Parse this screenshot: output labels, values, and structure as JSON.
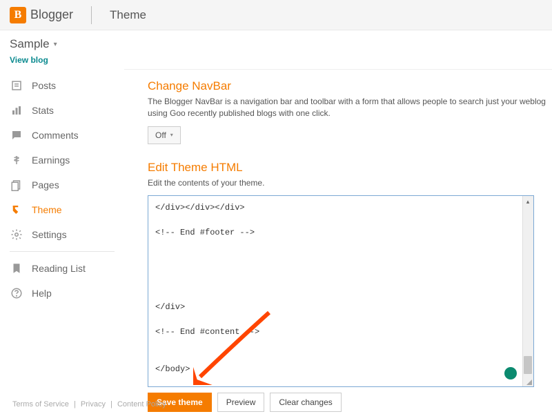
{
  "header": {
    "brand": "Blogger",
    "section": "Theme"
  },
  "blog": {
    "name": "Sample",
    "view_link": "View blog"
  },
  "sidebar": {
    "items": [
      {
        "label": "Posts",
        "icon": "posts-icon"
      },
      {
        "label": "Stats",
        "icon": "stats-icon"
      },
      {
        "label": "Comments",
        "icon": "comments-icon"
      },
      {
        "label": "Earnings",
        "icon": "earnings-icon"
      },
      {
        "label": "Pages",
        "icon": "pages-icon"
      },
      {
        "label": "Theme",
        "icon": "theme-icon"
      },
      {
        "label": "Settings",
        "icon": "settings-icon"
      }
    ],
    "secondary": [
      {
        "label": "Reading List",
        "icon": "reading-list-icon"
      },
      {
        "label": "Help",
        "icon": "help-icon"
      }
    ]
  },
  "main": {
    "navbar": {
      "title": "Change NavBar",
      "desc": "The Blogger NavBar is a navigation bar and toolbar with a form that allows people to search just your weblog using Goo recently published blogs with one click.",
      "toggle": "Off"
    },
    "edit_html": {
      "title": "Edit Theme HTML",
      "desc": "Edit the contents of your theme.",
      "code": "</div></div></div>\n\n<!-- End #footer -->\n\n\n\n\n\n</div>\n\n<!-- End #content -->\n\n\n</body>\n\n</html>",
      "buttons": {
        "save": "Save theme",
        "preview": "Preview",
        "clear": "Clear changes"
      }
    }
  },
  "footer": {
    "terms": "Terms of Service",
    "privacy": "Privacy",
    "content": "Content Policy"
  }
}
